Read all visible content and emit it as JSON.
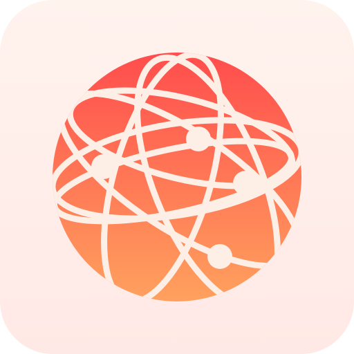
{
  "icon": {
    "name": "network-globe-icon",
    "colors": {
      "tile_top": "#fff3ee",
      "tile_bottom": "#ffe9e6",
      "globe_top": "#ff4d4d",
      "globe_bottom": "#ffa15e",
      "lines": "#fdeee6"
    }
  }
}
